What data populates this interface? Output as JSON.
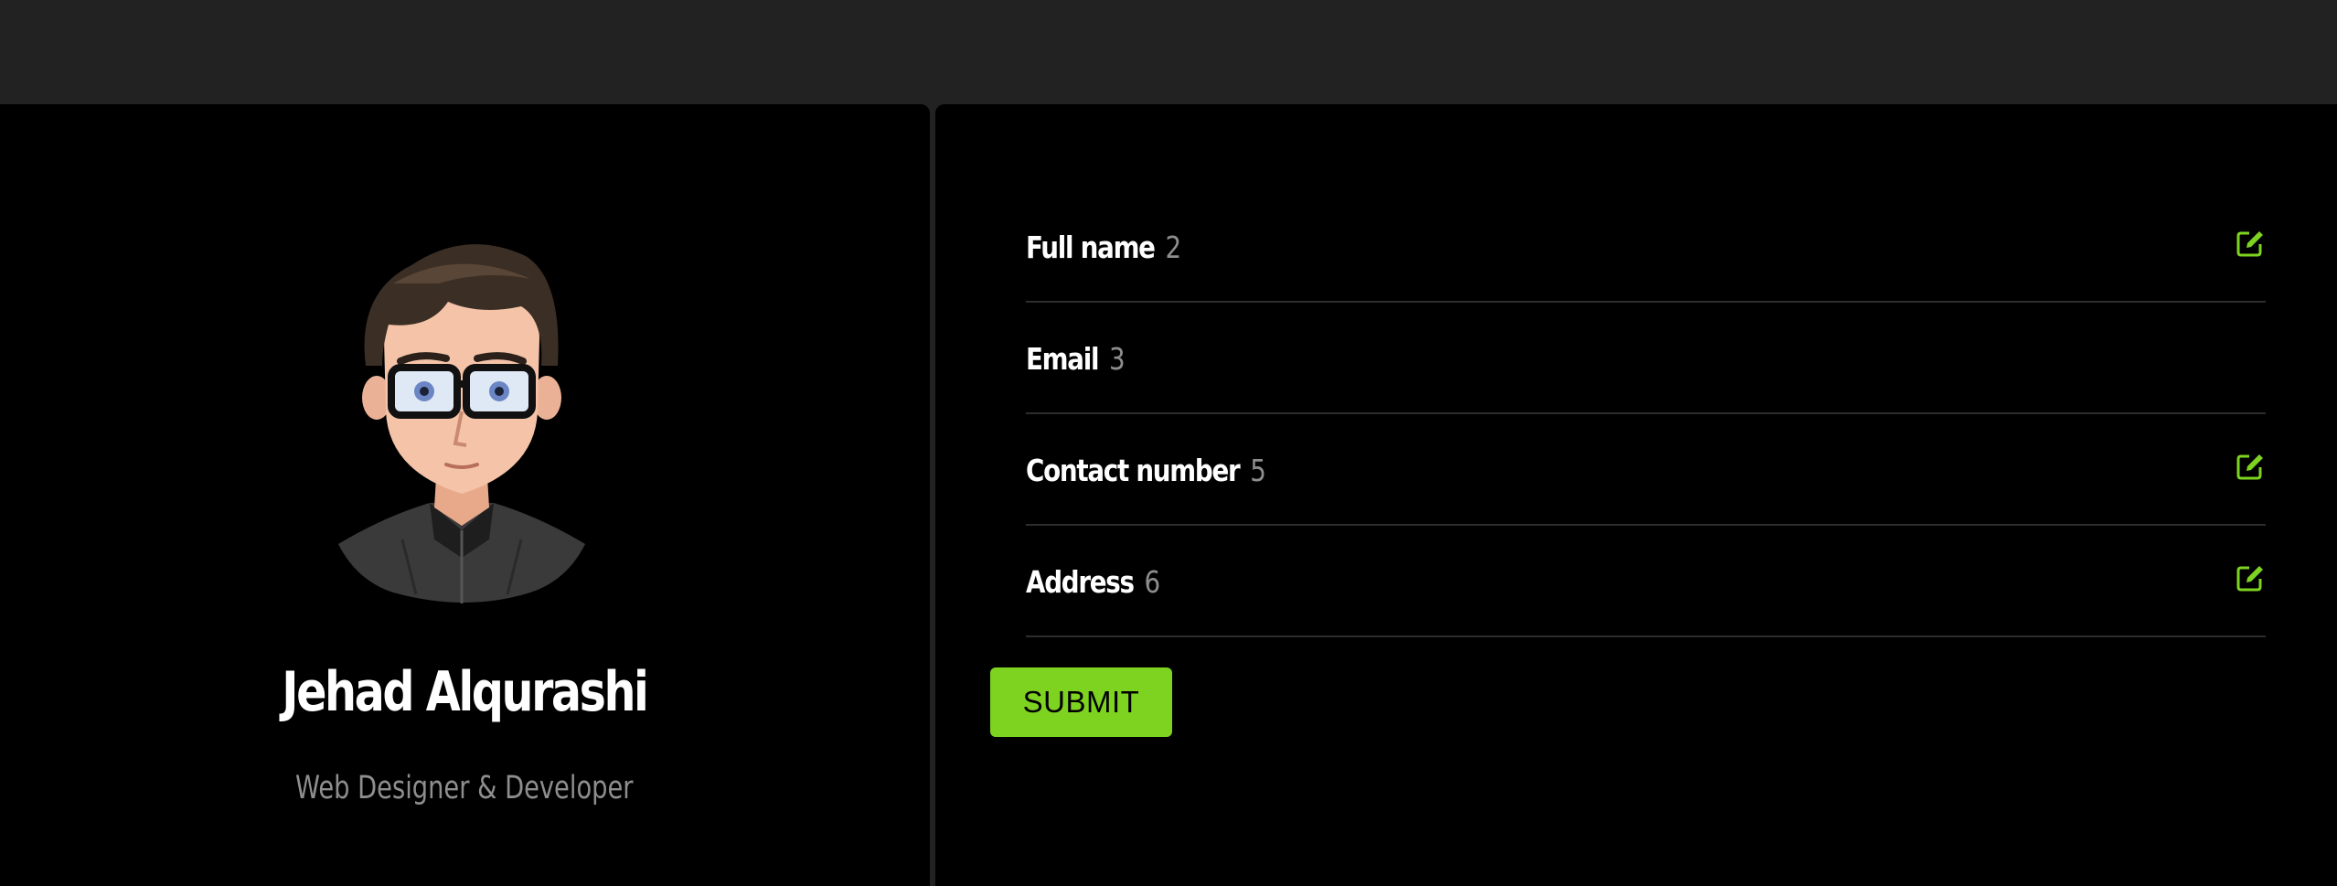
{
  "profile": {
    "name": "Jehad Alqurashi",
    "role": "Web Designer & Developer"
  },
  "fields": [
    {
      "label": "Full name",
      "value": "2",
      "editable": true
    },
    {
      "label": "Email",
      "value": "3",
      "editable": false
    },
    {
      "label": "Contact number",
      "value": "5",
      "editable": true
    },
    {
      "label": "Address",
      "value": "6",
      "editable": true
    }
  ],
  "form": {
    "submit_label": "SUBMIT"
  },
  "colors": {
    "accent": "#7ed321",
    "panel": "#000000",
    "background": "#222222",
    "muted_text": "#8e8e8e"
  },
  "icons": {
    "edit": "edit-icon"
  }
}
